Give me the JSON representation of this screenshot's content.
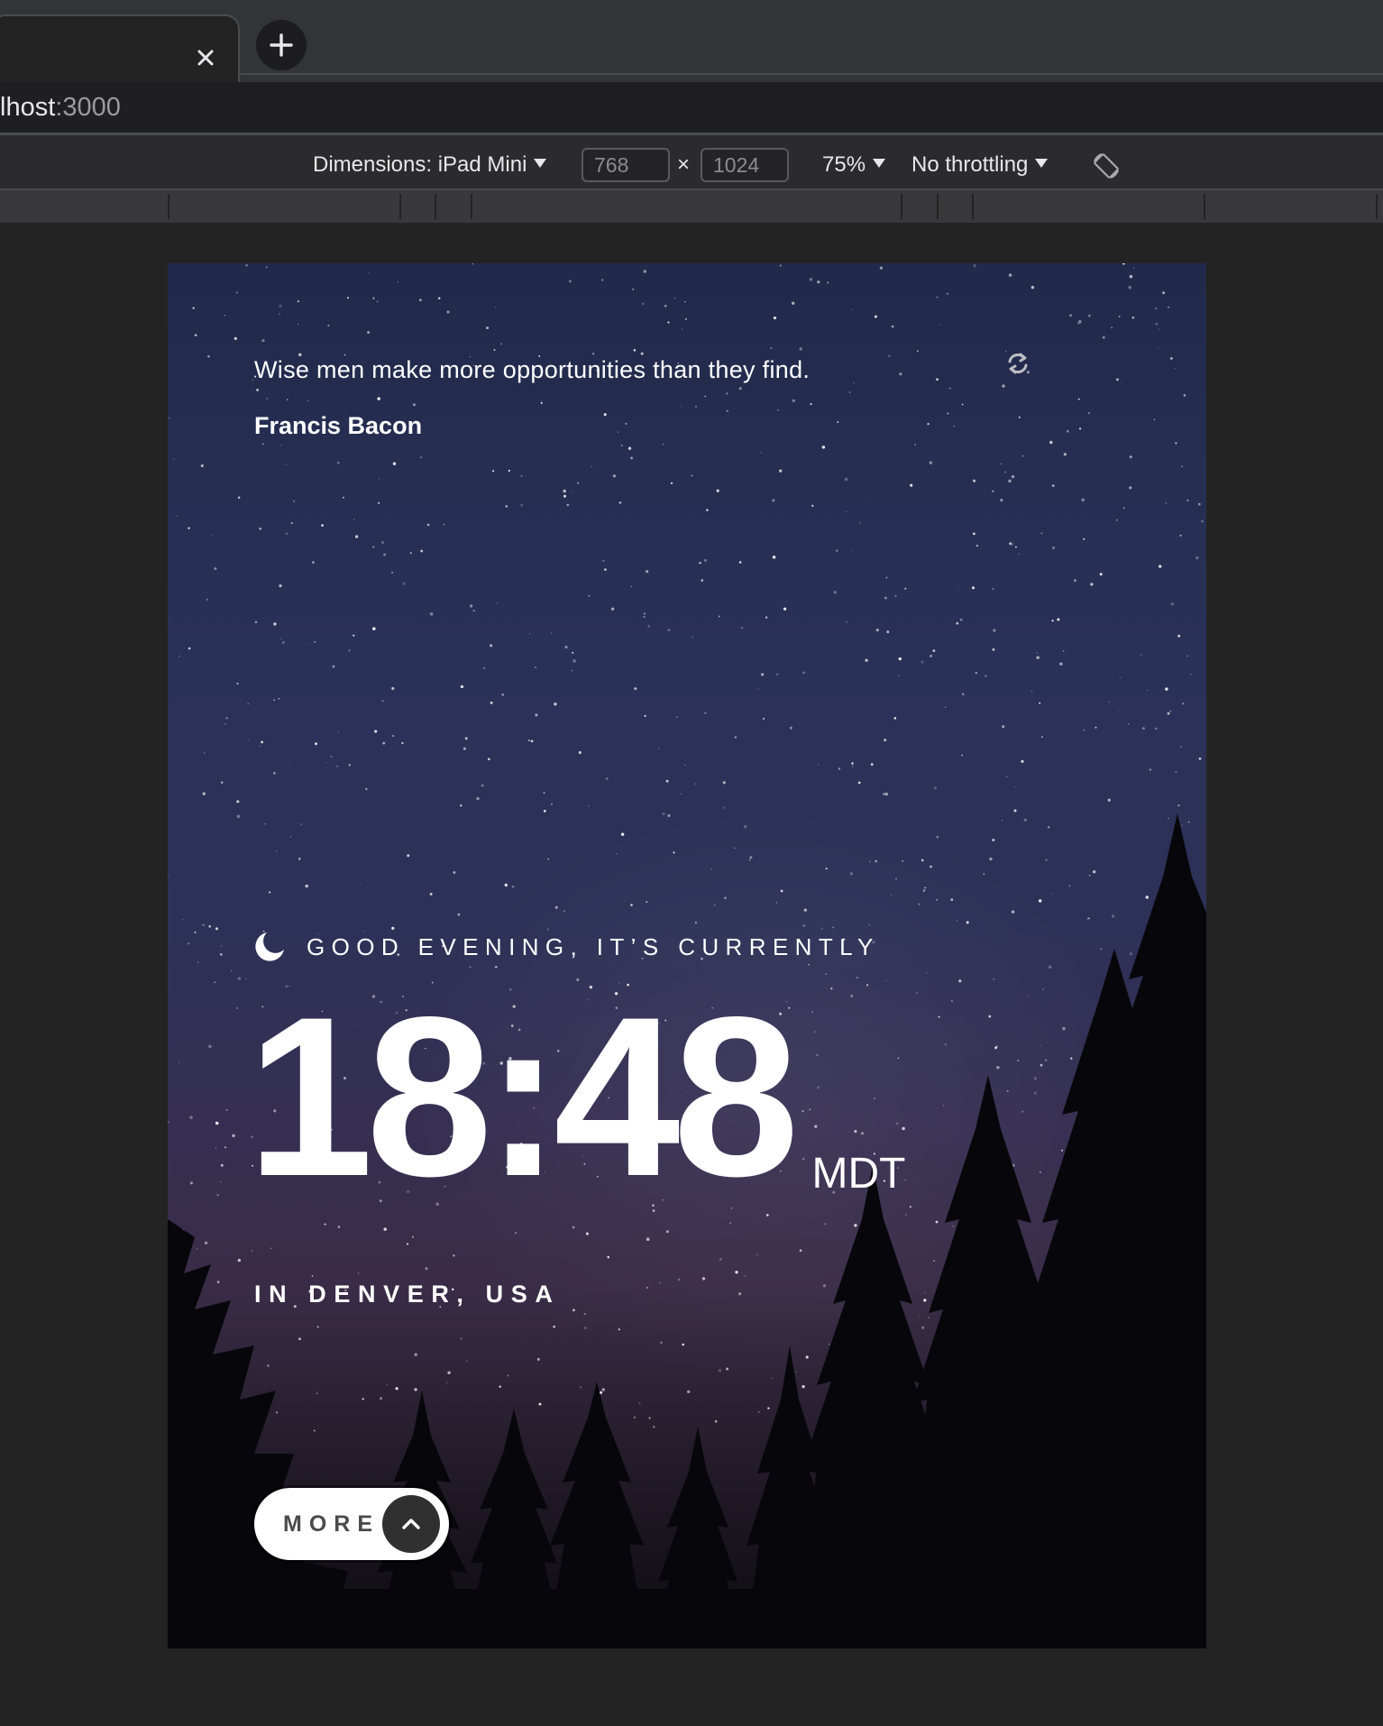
{
  "browser": {
    "address_host": "lhost",
    "address_port": ":3000"
  },
  "devtools": {
    "dimensions_label": "Dimensions: iPad Mini",
    "width_value": "768",
    "height_value": "1024",
    "times_sign": "×",
    "zoom_label": "75%",
    "throttling_label": "No throttling"
  },
  "app": {
    "quote": {
      "text": "Wise men make more opportunities than they find.",
      "author": "Francis Bacon"
    },
    "greeting": "GOOD EVENING, IT’S CURRENTLY",
    "time": "18:48",
    "timezone": "MDT",
    "location": "IN DENVER, USA",
    "more_button_label": "MORE"
  },
  "icons": {
    "tab_close": "close-icon",
    "new_tab": "plus-icon",
    "rotate": "rotate-device-icon",
    "refresh": "refresh-icon",
    "greeting": "moon-icon",
    "more": "chevron-up-icon"
  },
  "colors": {
    "sky_top": "#212a4a",
    "sky_bottom": "#0c0a10",
    "text": "#ffffff",
    "button_bg": "#ffffff",
    "button_arrow_bg": "#303030"
  }
}
